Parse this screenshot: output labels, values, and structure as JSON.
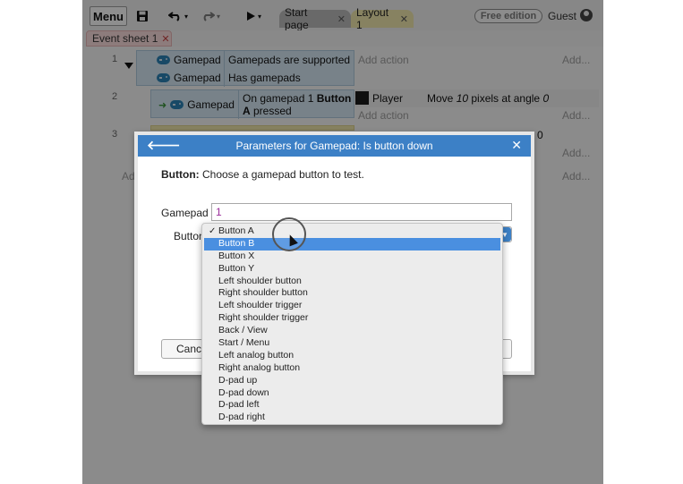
{
  "toolbar": {
    "menu_label": "Menu",
    "tabs": [
      {
        "label": "Start page"
      },
      {
        "label": "Layout 1"
      }
    ],
    "edition_badge": "Free edition",
    "user_label": "Guest"
  },
  "sheet_tab": {
    "label": "Event sheet 1"
  },
  "events": [
    {
      "number": "1",
      "conditions": [
        {
          "object": "Gamepad",
          "text": "Gamepads are supported"
        },
        {
          "object": "Gamepad",
          "text": "Has gamepads"
        }
      ],
      "add_action": "Add action",
      "add_dots": "Add..."
    },
    {
      "number": "2",
      "condition": {
        "object": "Gamepad",
        "text_pre": "On gamepad 1 ",
        "text_bold": "Button",
        "text_line2_bold": "A",
        "text_post": " pressed"
      },
      "action": {
        "object": "Player",
        "text_pre": "Move ",
        "text_italic1": "10",
        "text_mid": " pixels at angle ",
        "text_italic2": "0"
      },
      "add_action": "Add action",
      "add_dots": "Add..."
    },
    {
      "number": "3",
      "partial_value": "0",
      "add_dots": "Add...",
      "add_dots_2": "Add..."
    }
  ],
  "sheet_partial_add": "Ad",
  "dialog": {
    "title": "Parameters for Gamepad: Is button down",
    "description_bold": "Button:",
    "description_text": " Choose a gamepad button to test.",
    "gamepad_label": "Gamepad",
    "gamepad_value": "1",
    "button_label": "Button",
    "cancel_label": "Cancel"
  },
  "dropdown": {
    "checked_option": "Button A",
    "highlighted_option": "Button B",
    "options": [
      "Button A",
      "Button B",
      "Button X",
      "Button Y",
      "Left shoulder button",
      "Right shoulder button",
      "Left shoulder trigger",
      "Right shoulder trigger",
      "Back / View",
      "Start / Menu",
      "Left analog button",
      "Right analog button",
      "D-pad up",
      "D-pad down",
      "D-pad left",
      "D-pad right"
    ]
  },
  "colors": {
    "dialog_title_bg": "#3c80c6",
    "highlight": "#4a8fe0",
    "condition_bg": "#cfe0ec",
    "gamepad_value": "#9b2d9b"
  }
}
